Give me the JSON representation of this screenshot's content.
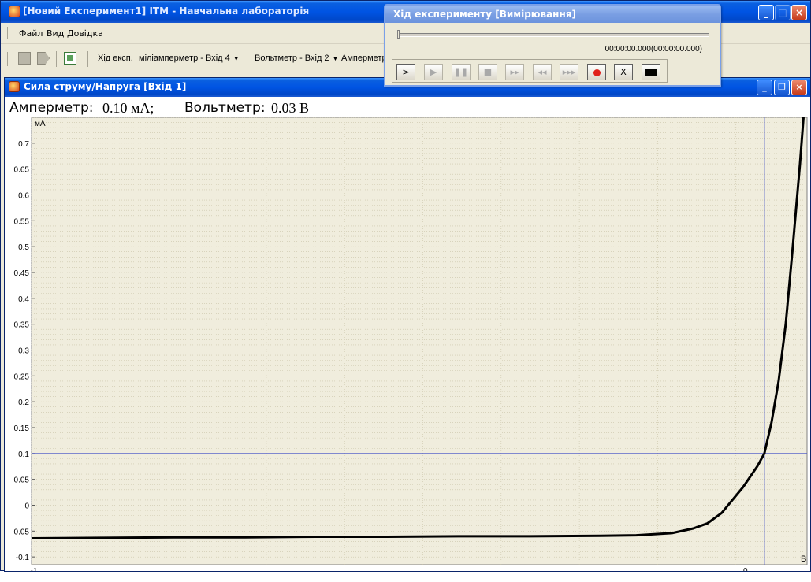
{
  "app": {
    "title": "[Новий Експеримент1]  ITM - Навчальна лабораторія",
    "menu": [
      "Файл",
      "Вид",
      "Довідка"
    ],
    "toolbar": {
      "exp_label": "Хід експ.",
      "device1": "міліамперметр - Вхід 4",
      "device2": "Вольтметр - Вхід 2",
      "device3": "Амперметр"
    }
  },
  "progress_window": {
    "title": "Хід експерименту [Вимірювання]",
    "timer": "00:00:00.000(00:00:00.000)",
    "progress": 0.0,
    "buttons": [
      "play-icon",
      "step-icon",
      "pause-icon",
      "stop-icon",
      "fast-forward-icon",
      "rewind-icon",
      "skip-icon",
      "record-icon",
      "cancel-icon",
      "screen-icon"
    ],
    "play_label": ">",
    "cancel_label": "X"
  },
  "child_window": {
    "title": "Сила струму/Напруга [Вхід 1]",
    "ammeter_label": "Амперметр:",
    "ammeter_value": "0.10 мА;",
    "voltmeter_label": "Вольтметр:",
    "voltmeter_value": "0.03 В"
  },
  "chart_data": {
    "type": "line",
    "xlabel": "В",
    "ylabel": "мА",
    "xlim": [
      -1.0,
      0.09
    ],
    "ylim": [
      -0.115,
      0.75
    ],
    "x_ticks": [
      -1,
      0
    ],
    "y_ticks": [
      -0.1,
      -0.05,
      0,
      0.05,
      0.1,
      0.15,
      0.2,
      0.25,
      0.3,
      0.35,
      0.4,
      0.45,
      0.5,
      0.55,
      0.6,
      0.65,
      0.7
    ],
    "x_tick_labels": [
      "-1",
      "0"
    ],
    "y_tick_labels": [
      "-0.1",
      "-0.05",
      "0",
      "0.05",
      "0.1",
      "0.15",
      "0.2",
      "0.25",
      "0.3",
      "0.35",
      "0.4",
      "0.45",
      "0.5",
      "0.55",
      "0.6",
      "0.65",
      "0.7"
    ],
    "cursor": {
      "x": 0.03,
      "y": 0.1
    },
    "grid": true,
    "series": [
      {
        "color": "#000000",
        "points": [
          [
            -1.0,
            -0.064
          ],
          [
            -0.9,
            -0.063
          ],
          [
            -0.8,
            -0.062
          ],
          [
            -0.7,
            -0.062
          ],
          [
            -0.6,
            -0.061
          ],
          [
            -0.5,
            -0.061
          ],
          [
            -0.4,
            -0.06
          ],
          [
            -0.3,
            -0.06
          ],
          [
            -0.2,
            -0.059
          ],
          [
            -0.15,
            -0.058
          ],
          [
            -0.1,
            -0.054
          ],
          [
            -0.07,
            -0.045
          ],
          [
            -0.05,
            -0.035
          ],
          [
            -0.03,
            -0.015
          ],
          [
            -0.015,
            0.01
          ],
          [
            0.0,
            0.035
          ],
          [
            0.01,
            0.055
          ],
          [
            0.02,
            0.075
          ],
          [
            0.03,
            0.1
          ],
          [
            0.04,
            0.16
          ],
          [
            0.05,
            0.24
          ],
          [
            0.06,
            0.35
          ],
          [
            0.07,
            0.5
          ],
          [
            0.08,
            0.66
          ],
          [
            0.085,
            0.75
          ]
        ]
      }
    ]
  },
  "colors": {
    "plot_bg": "#f0eddd",
    "grid": "#c9c4a8",
    "cursor": "#3d4bc7",
    "line": "#000000"
  }
}
